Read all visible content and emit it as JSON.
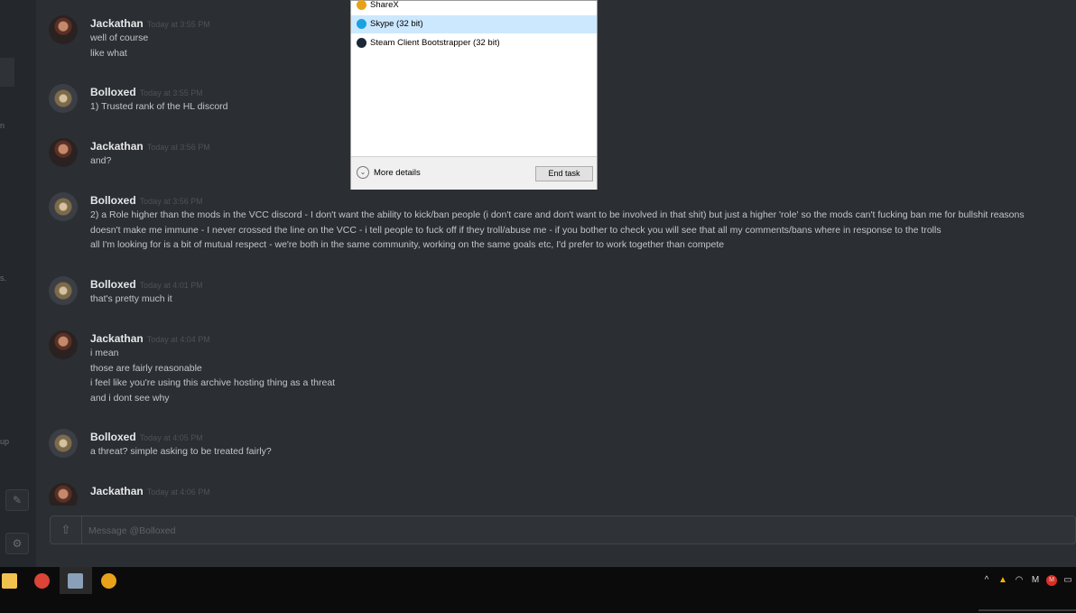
{
  "sidebar": {
    "fragments": [
      {
        "text": "n"
      },
      {
        "text": "s."
      },
      {
        "text": "up"
      }
    ],
    "icons": [
      {
        "name": "pen-icon",
        "glyph": "✎"
      },
      {
        "name": "settings-icon",
        "glyph": "⚙"
      }
    ]
  },
  "messages": [
    {
      "author": "Jackathan",
      "avatar": "jack",
      "timestamp": "Today at 3:55 PM",
      "lines": [
        "well of course",
        "like what"
      ]
    },
    {
      "author": "Bolloxed",
      "avatar": "boll",
      "timestamp": "Today at 3:55 PM",
      "lines": [
        "1) Trusted rank of the HL discord"
      ]
    },
    {
      "author": "Jackathan",
      "avatar": "jack",
      "timestamp": "Today at 3:56 PM",
      "lines": [
        "and?"
      ]
    },
    {
      "author": "Bolloxed",
      "avatar": "boll",
      "timestamp": "Today at 3:56 PM",
      "lines": [
        "2) a Role higher than the mods in the VCC discord -  I don't want the ability to kick/ban people (i don't care and don't want to be involved in that shit) but just a higher 'role' so the mods can't fucking ban me for bullshit reasons",
        "doesn't make me immune - I never crossed the line on the VCC - i tell people to fuck off if they troll/abuse me - if you bother to check you will see that all my comments/bans where in response to the trolls",
        "all I'm looking for is a bit of mutual respect - we're both in the same community, working on the same goals etc, I'd prefer to work together than compete"
      ]
    },
    {
      "author": "Bolloxed",
      "avatar": "boll",
      "timestamp": "Today at 4:01 PM",
      "lines": [
        "that's pretty much it"
      ]
    },
    {
      "author": "Jackathan",
      "avatar": "jack",
      "timestamp": "Today at 4:04 PM",
      "lines": [
        "i mean",
        "those are fairly reasonable",
        "i feel like you're using this archive hosting thing as a threat",
        "and i dont see why"
      ]
    },
    {
      "author": "Bolloxed",
      "avatar": "boll",
      "timestamp": "Today at 4:05 PM",
      "lines": [
        "a threat? simple asking to be treated fairly?"
      ]
    },
    {
      "author": "Jackathan",
      "avatar": "jack",
      "timestamp": "Today at 4:06 PM",
      "lines": []
    }
  ],
  "compose": {
    "placeholder": "Message @Bolloxed"
  },
  "task_manager": {
    "processes": [
      {
        "label": "ShareX",
        "icon": "sharex-icon",
        "color": "#e8a21a",
        "selected": false
      },
      {
        "label": "Skype (32 bit)",
        "icon": "skype-icon",
        "color": "#1aa1e1",
        "selected": true
      },
      {
        "label": "Steam Client Bootstrapper (32 bit)",
        "icon": "steam-icon",
        "color": "#1b2838",
        "selected": false
      }
    ],
    "more_details": "More details",
    "end_task": "End task"
  },
  "taskbar": {
    "apps": [
      {
        "name": "file-explorer-icon",
        "color": "#f2c14e",
        "active": false
      },
      {
        "name": "chrome-icon",
        "color": "#db4437",
        "active": false
      },
      {
        "name": "task-manager-icon",
        "color": "#8aa0b8",
        "active": true
      },
      {
        "name": "sharex-icon",
        "color": "#e8a21a",
        "active": false
      }
    ],
    "tray": [
      {
        "name": "chevron-up-icon",
        "glyph": "^"
      },
      {
        "name": "google-drive-icon",
        "glyph": "▲"
      },
      {
        "name": "wifi-icon",
        "glyph": "◠"
      },
      {
        "name": "mail-icon",
        "glyph": "M"
      },
      {
        "name": "gmail-icon",
        "glyph": "M"
      },
      {
        "name": "screen-icon",
        "glyph": "▭"
      }
    ]
  },
  "colors": {
    "background": "#2b2e33",
    "selection": "#cce8ff"
  }
}
